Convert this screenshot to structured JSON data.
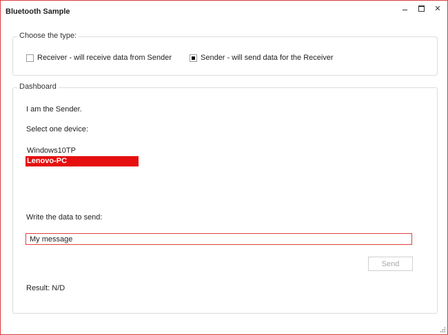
{
  "window": {
    "title": "Bluetooth Sample",
    "controls": {
      "minimize": "minimize-icon",
      "maximize": "maximize-icon",
      "close": "✕"
    }
  },
  "type_group": {
    "label": "Choose the type:",
    "receiver": {
      "label": "Receiver - will receive data from Sender",
      "checked": false
    },
    "sender": {
      "label": "Sender - will send data for the Receiver",
      "checked": true
    }
  },
  "dashboard": {
    "label": "Dashboard",
    "status": "I am the Sender.",
    "select_prompt": "Select one device:",
    "devices": [
      {
        "name": "Windows10TP",
        "selected": false
      },
      {
        "name": "Lenovo-PC",
        "selected": true
      }
    ],
    "write_prompt": "Write the data to send:",
    "message_value": "My message",
    "send_label": "Send",
    "result": "Result: N/D"
  },
  "colors": {
    "accent": "#e50f0f",
    "window_border": "#d93a3a"
  }
}
